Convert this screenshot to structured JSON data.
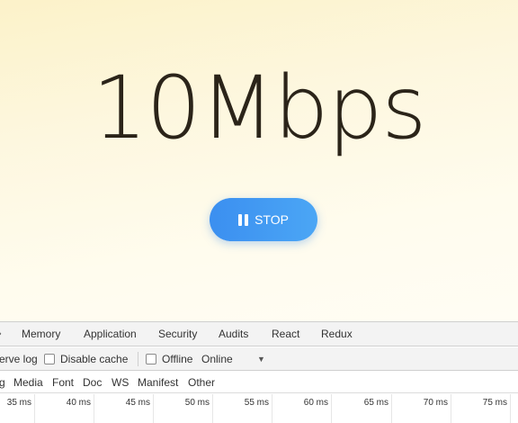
{
  "app": {
    "speed_value": "10Mbps",
    "stop_button_label": "STOP"
  },
  "devtools": {
    "tabs": [
      "Memory",
      "Application",
      "Security",
      "Audits",
      "React",
      "Redux"
    ],
    "toolbar": {
      "preserve_log_label": "erve log",
      "disable_cache_label": "Disable cache",
      "offline_label": "Offline",
      "throttle_value": "Online"
    },
    "filters": [
      "g",
      "Media",
      "Font",
      "Doc",
      "WS",
      "Manifest",
      "Other"
    ],
    "timeline_ticks": [
      "35 ms",
      "40 ms",
      "45 ms",
      "50 ms",
      "55 ms",
      "60 ms",
      "65 ms",
      "70 ms",
      "75 ms"
    ]
  },
  "colors": {
    "button_start": "#3b8ff0",
    "button_end": "#4ba6f5",
    "speed_text": "#2b2419"
  },
  "icons": {
    "stop_button": "pause-icon",
    "overflow": "chevron-left-icon",
    "throttle_dropdown": "dropdown-arrow-icon"
  }
}
